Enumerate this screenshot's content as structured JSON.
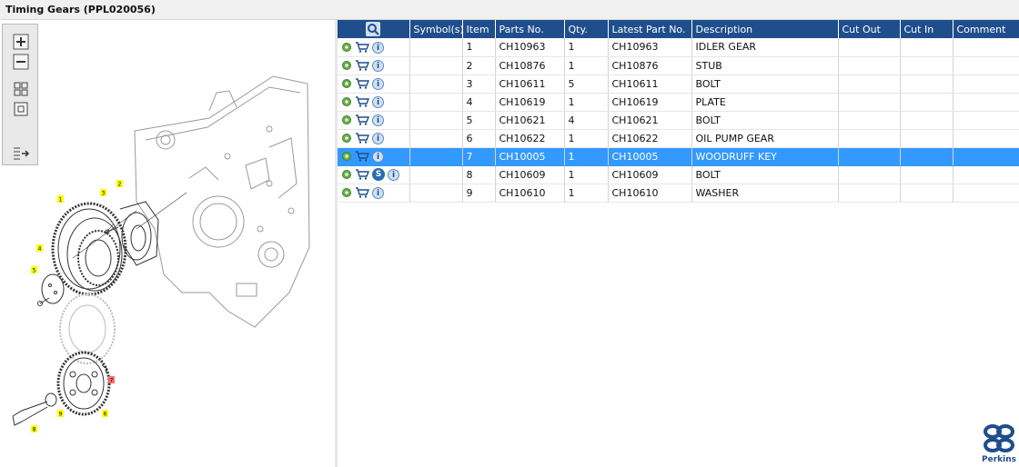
{
  "window": {
    "title": "Timing Gears (PPL020056)"
  },
  "toolbar": {
    "buttons": [
      {
        "name": "zoom-in",
        "icon": "plus-icon"
      },
      {
        "name": "zoom-out",
        "icon": "minus-icon"
      },
      {
        "name": "fit-all",
        "icon": "grid-icon"
      },
      {
        "name": "fit-window",
        "icon": "square-icon"
      },
      {
        "name": "export",
        "icon": "export-list-icon"
      }
    ]
  },
  "diagram": {
    "callouts": [
      "1",
      "2",
      "3",
      "4",
      "5",
      "6",
      "7",
      "8",
      "9"
    ],
    "colors": {
      "callout": "#ffff00",
      "highlight": "#ff6b6b",
      "line": "#333333"
    }
  },
  "table": {
    "headers": [
      "",
      "Symbol(s)",
      "Item",
      "Parts No.",
      "Qty.",
      "Latest Part No.",
      "Description",
      "Cut Out",
      "Cut In",
      "Comment"
    ],
    "rows": [
      {
        "item": "1",
        "part_no": "CH10963",
        "qty": "1",
        "latest_part_no": "CH10963",
        "description": "IDLER GEAR",
        "cut_out": "",
        "cut_in": "",
        "comment": "",
        "symbol": ""
      },
      {
        "item": "2",
        "part_no": "CH10876",
        "qty": "1",
        "latest_part_no": "CH10876",
        "description": "STUB",
        "cut_out": "",
        "cut_in": "",
        "comment": "",
        "symbol": ""
      },
      {
        "item": "3",
        "part_no": "CH10611",
        "qty": "5",
        "latest_part_no": "CH10611",
        "description": "BOLT",
        "cut_out": "",
        "cut_in": "",
        "comment": "",
        "symbol": ""
      },
      {
        "item": "4",
        "part_no": "CH10619",
        "qty": "1",
        "latest_part_no": "CH10619",
        "description": "PLATE",
        "cut_out": "",
        "cut_in": "",
        "comment": "",
        "symbol": ""
      },
      {
        "item": "5",
        "part_no": "CH10621",
        "qty": "4",
        "latest_part_no": "CH10621",
        "description": "BOLT",
        "cut_out": "",
        "cut_in": "",
        "comment": "",
        "symbol": ""
      },
      {
        "item": "6",
        "part_no": "CH10622",
        "qty": "1",
        "latest_part_no": "CH10622",
        "description": "OIL PUMP GEAR",
        "cut_out": "",
        "cut_in": "",
        "comment": "",
        "symbol": ""
      },
      {
        "item": "7",
        "part_no": "CH10005",
        "qty": "1",
        "latest_part_no": "CH10005",
        "description": "WOODRUFF KEY",
        "cut_out": "",
        "cut_in": "",
        "comment": "",
        "symbol": "",
        "selected": true
      },
      {
        "item": "8",
        "part_no": "CH10609",
        "qty": "1",
        "latest_part_no": "CH10609",
        "description": "BOLT",
        "cut_out": "",
        "cut_in": "",
        "comment": "",
        "symbol": "S"
      },
      {
        "item": "9",
        "part_no": "CH10610",
        "qty": "1",
        "latest_part_no": "CH10610",
        "description": "WASHER",
        "cut_out": "",
        "cut_in": "",
        "comment": "",
        "symbol": ""
      }
    ],
    "row_icons": [
      "gear-icon",
      "cart-icon",
      "info-icon"
    ],
    "colors": {
      "header_bg": "#1f4e8c",
      "selected_bg": "#3399ff"
    }
  },
  "logo": {
    "text": "Perkins"
  }
}
